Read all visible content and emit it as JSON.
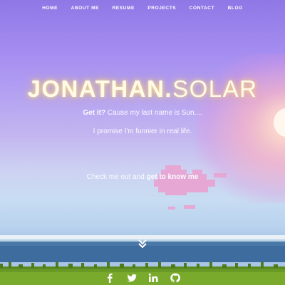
{
  "nav": {
    "items": [
      "HOME",
      "ABOUT ME",
      "RESUME",
      "PROJECTS",
      "CONTACT",
      "BLOG"
    ]
  },
  "hero": {
    "title_bold": "JONATHAN.",
    "title_thin": "SOLAR",
    "line1_bold": "Get it?",
    "line1_rest": " Cause my last name is Sun....",
    "line2": "I promise I'm funnier in real life.",
    "line3_pre": "Check me out and ",
    "line3_link": "get to know me"
  },
  "scroll": {
    "icon": "double-chevron-down-icon"
  },
  "social": {
    "icons": [
      "facebook-icon",
      "twitter-icon",
      "linkedin-icon",
      "github-icon"
    ],
    "icon_color": "#ffffff"
  },
  "colors": {
    "sky_top": "#8f78e6",
    "sun_glow": "#f5afc8",
    "cloud": "#e6a7d5",
    "sea": "#4a78a8",
    "grass": "#6a9a26",
    "title_glow": "#ffdc78"
  }
}
